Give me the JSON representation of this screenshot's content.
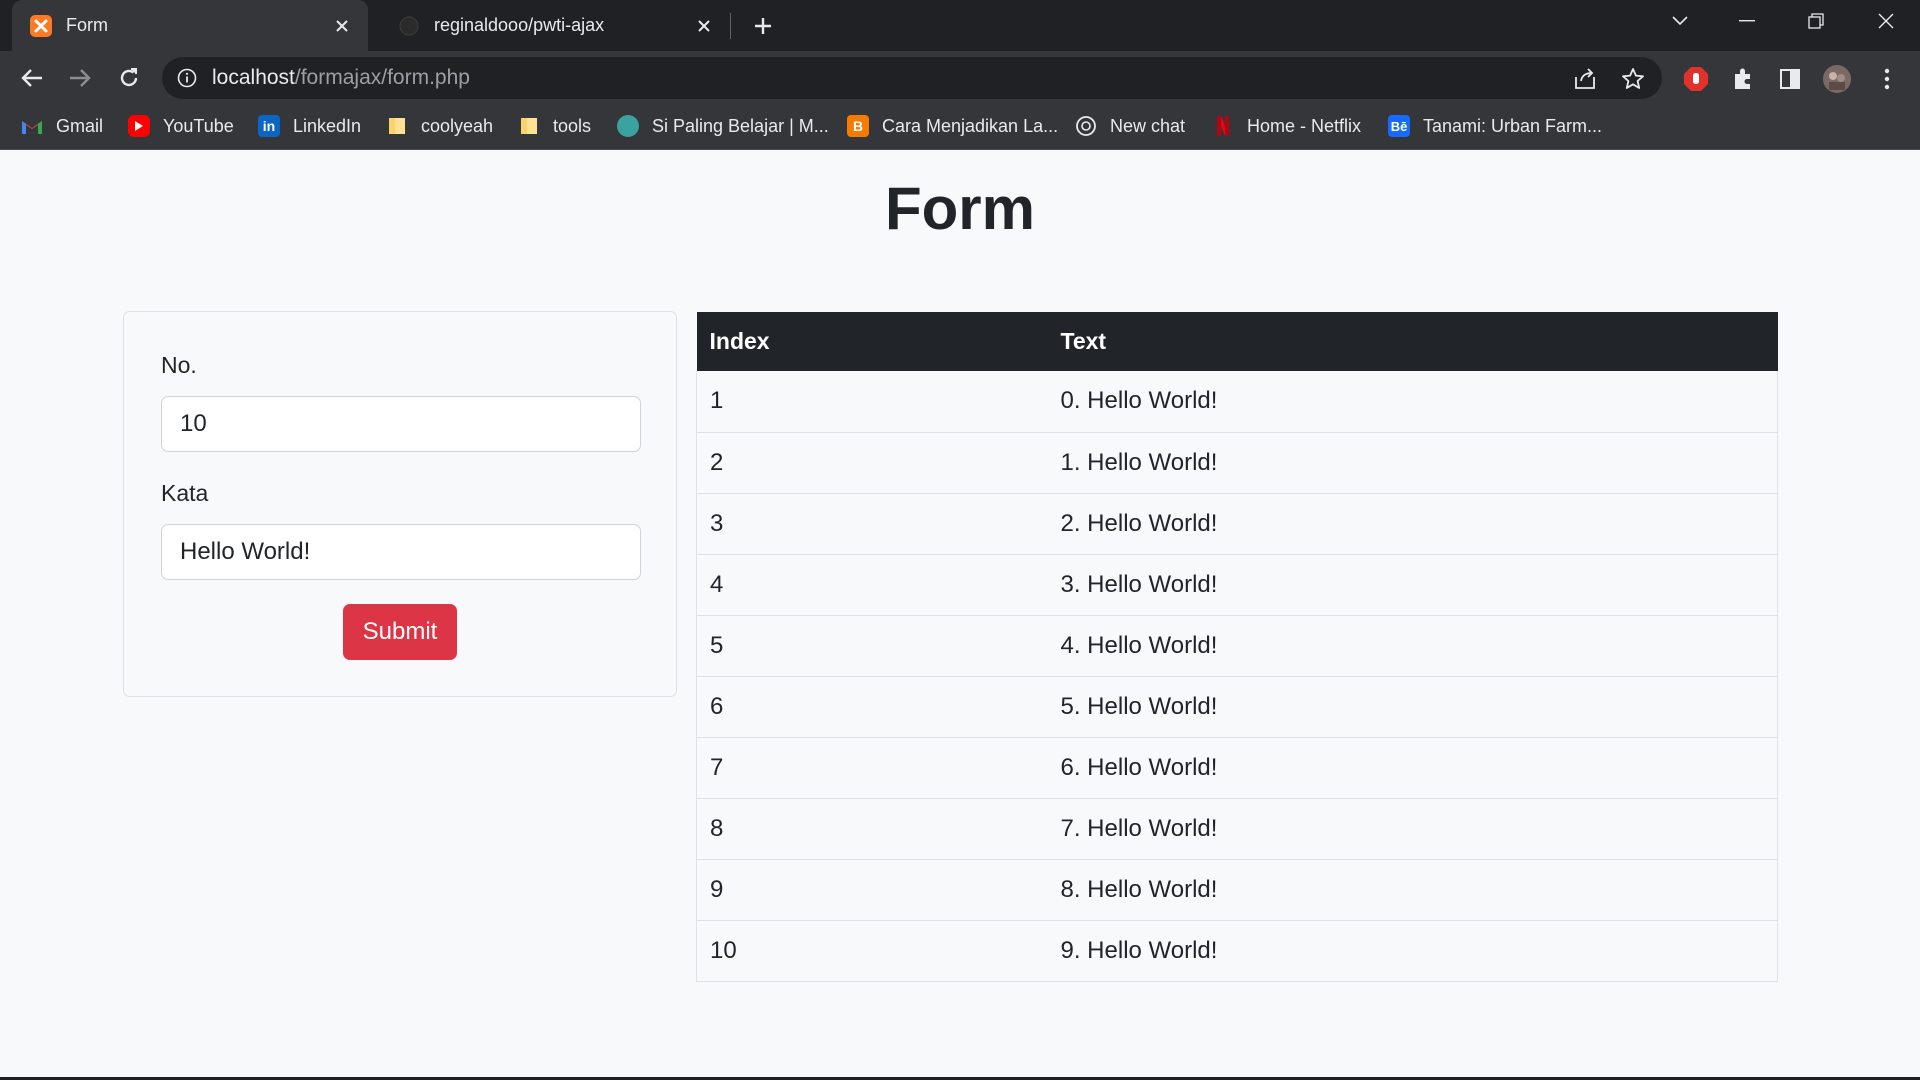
{
  "browser": {
    "tabs": [
      {
        "title": "Form",
        "active": true,
        "icon": "xampp-icon"
      },
      {
        "title": "reginaldooo/pwti-ajax",
        "active": false,
        "icon": "github-icon"
      }
    ],
    "address": {
      "host": "localhost",
      "path": "/formajax/form.php"
    },
    "bookmarks": [
      {
        "label": "Gmail",
        "icon": "gmail-icon"
      },
      {
        "label": "YouTube",
        "icon": "youtube-icon"
      },
      {
        "label": "LinkedIn",
        "icon": "linkedin-icon"
      },
      {
        "label": "coolyeah",
        "icon": "folder-icon"
      },
      {
        "label": "tools",
        "icon": "folder-icon"
      },
      {
        "label": "Si Paling Belajar | M...",
        "icon": "site-icon"
      },
      {
        "label": "Cara Menjadikan La...",
        "icon": "blogger-icon"
      },
      {
        "label": "New chat",
        "icon": "chatgpt-icon"
      },
      {
        "label": "Home - Netflix",
        "icon": "netflix-icon"
      },
      {
        "label": "Tanami: Urban Farm...",
        "icon": "behance-icon"
      }
    ]
  },
  "page": {
    "title": "Form",
    "form": {
      "no_label": "No.",
      "no_value": "10",
      "kata_label": "Kata",
      "kata_value": "Hello World!",
      "submit_label": "Submit"
    },
    "table": {
      "headers": [
        "Index",
        "Text"
      ],
      "rows": [
        [
          "1",
          "0. Hello World!"
        ],
        [
          "2",
          "1. Hello World!"
        ],
        [
          "3",
          "2. Hello World!"
        ],
        [
          "4",
          "3. Hello World!"
        ],
        [
          "5",
          "4. Hello World!"
        ],
        [
          "6",
          "5. Hello World!"
        ],
        [
          "7",
          "6. Hello World!"
        ],
        [
          "8",
          "7. Hello World!"
        ],
        [
          "9",
          "8. Hello World!"
        ],
        [
          "10",
          "9. Hello World!"
        ]
      ]
    }
  },
  "colors": {
    "submit_button": "#dc3545",
    "table_header": "#212529",
    "page_background": "#f8f9fa"
  }
}
